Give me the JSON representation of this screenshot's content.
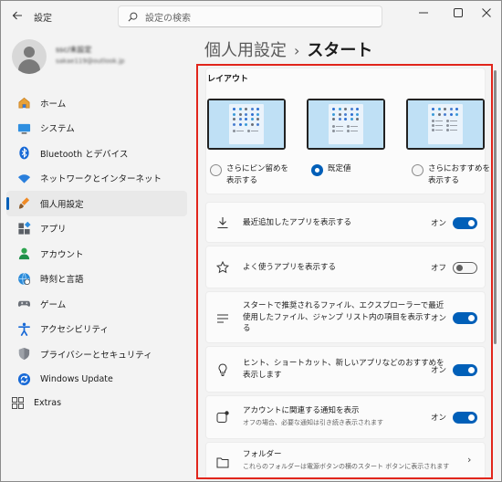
{
  "window": {
    "app_title": "設定",
    "controls": {
      "minimize": "—",
      "maximize": "☐",
      "close": "✕"
    }
  },
  "search": {
    "placeholder": "設定の検索"
  },
  "profile": {
    "name": "ssc/未設定",
    "email": "sakae119@outlook.jp"
  },
  "nav": [
    {
      "label": "ホーム",
      "icon": "home-icon"
    },
    {
      "label": "システム",
      "icon": "system-icon"
    },
    {
      "label": "Bluetooth とデバイス",
      "icon": "bluetooth-icon"
    },
    {
      "label": "ネットワークとインターネット",
      "icon": "network-icon"
    },
    {
      "label": "個人用設定",
      "icon": "personalization-icon",
      "active": true
    },
    {
      "label": "アプリ",
      "icon": "apps-icon"
    },
    {
      "label": "アカウント",
      "icon": "account-icon"
    },
    {
      "label": "時刻と言語",
      "icon": "time-language-icon"
    },
    {
      "label": "ゲーム",
      "icon": "gaming-icon"
    },
    {
      "label": "アクセシビリティ",
      "icon": "accessibility-icon"
    },
    {
      "label": "プライバシーとセキュリティ",
      "icon": "privacy-icon"
    },
    {
      "label": "Windows Update",
      "icon": "windows-update-icon"
    }
  ],
  "extras": {
    "label": "Extras",
    "icon": "extras-icon"
  },
  "breadcrumb": {
    "parent": "個人用設定",
    "separator": "›",
    "current": "スタート"
  },
  "layout": {
    "title": "レイアウト",
    "options": [
      {
        "label": "さらにピン留めを\n表示する",
        "checked": false
      },
      {
        "label": "既定値",
        "checked": true
      },
      {
        "label": "さらにおすすめを\n表示する",
        "checked": false
      }
    ]
  },
  "settings": [
    {
      "label": "最近追加したアプリを表示する",
      "state": "オン",
      "on": true,
      "icon": "download-icon"
    },
    {
      "label": "よく使うアプリを表示する",
      "state": "オフ",
      "on": false,
      "icon": "star-icon"
    },
    {
      "label": "スタートで推奨されるファイル、エクスプローラーで最近\n使用したファイル、ジャンプ リスト内の項目を表示す\nる",
      "state": "オン",
      "on": true,
      "icon": "list-icon"
    },
    {
      "label": "ヒント、ショートカット、新しいアプリなどのおすすめを\n表示します",
      "state": "オン",
      "on": true,
      "icon": "lightbulb-icon"
    },
    {
      "label": "アカウントに関連する通知を表示",
      "sub": "オフの場合、必要な通知は引き続き表示されます",
      "state": "オン",
      "on": true,
      "icon": "notification-icon"
    },
    {
      "label": "フォルダー",
      "sub": "これらのフォルダーは電源ボタンの横のスタート ボタンに表示されます",
      "icon": "folder-icon"
    }
  ],
  "colors": {
    "accent": "#005fb8",
    "highlight_border": "#e1251b"
  }
}
